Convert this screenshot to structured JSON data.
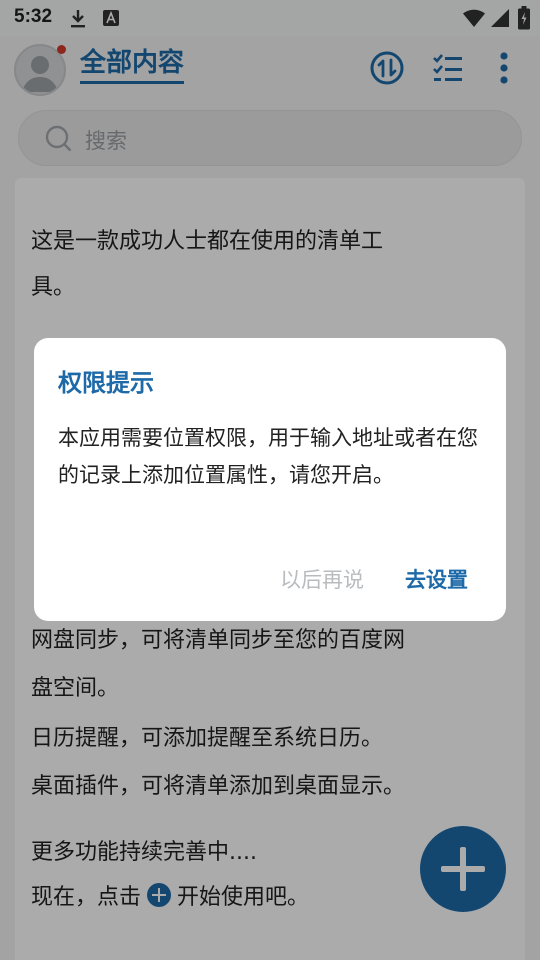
{
  "status_bar": {
    "time": "5:32"
  },
  "header": {
    "title": "全部内容"
  },
  "search": {
    "placeholder": "搜索"
  },
  "intro": {
    "line1": "这是一款成功人士都在使用的清单工",
    "line2": "具。",
    "line3": "网盘同步，可将清单同步至您的百度网",
    "line4": "盘空间。",
    "line5": "日历提醒，可添加提醒至系统日历。",
    "line6": "桌面插件，可将清单添加到桌面显示。",
    "line7": "更多功能持续完善中....",
    "line8_before": "现在，点击",
    "line8_after": "开始使用吧。"
  },
  "dialog": {
    "title": "权限提示",
    "message": "本应用需要位置权限，用于输入地址或者在您的记录上添加位置属性，请您开启。",
    "cancel_label": "以后再说",
    "confirm_label": "去设置"
  },
  "colors": {
    "accent": "#1e6aa8",
    "badge": "#d23a2b"
  },
  "icons": [
    "download-icon",
    "a-icon",
    "wifi-icon",
    "signal-icon",
    "battery-icon",
    "sort-icon",
    "checklist-icon",
    "more-icon",
    "search-icon",
    "add-icon"
  ]
}
